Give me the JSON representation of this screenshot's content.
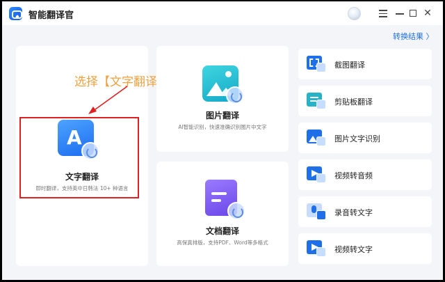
{
  "app": {
    "title": "智能翻译官"
  },
  "header": {
    "result_link": "转换结果 〉"
  },
  "annotation": {
    "text": "选择【文字翻译】"
  },
  "cards": {
    "text": {
      "title": "文字翻译",
      "desc": "即时翻译，支持英中日韩法 10+ 种语言"
    },
    "image": {
      "title": "图片翻译",
      "desc": "AI智能识别，快速准确识别图片中文字"
    },
    "doc": {
      "title": "文档翻译",
      "desc": "高保真排版，支持PDF、Word等多格式"
    }
  },
  "side_tools": [
    {
      "label": "截图翻译",
      "icon": "screenshot-translate-icon"
    },
    {
      "label": "剪贴板翻译",
      "icon": "clipboard-translate-icon"
    },
    {
      "label": "图片文字识别",
      "icon": "image-ocr-icon"
    },
    {
      "label": "视频转音频",
      "icon": "video-to-audio-icon"
    },
    {
      "label": "录音转文字",
      "icon": "recording-to-text-icon"
    },
    {
      "label": "视频转文字",
      "icon": "video-to-text-icon"
    }
  ],
  "colors": {
    "accent": "#1f6fe8",
    "highlight": "#e02020",
    "annotation": "#f0a040"
  }
}
